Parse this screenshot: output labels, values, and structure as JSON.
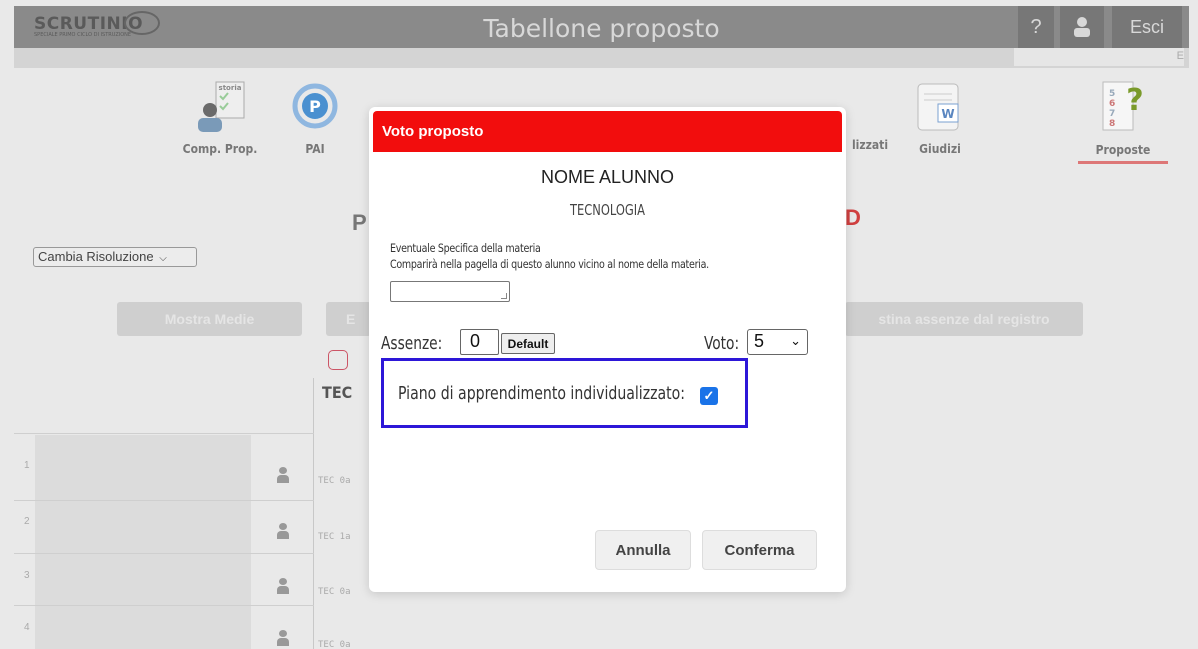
{
  "header": {
    "logo_text": "SCRUTINIO",
    "logo_sub": "SPECIALE PRIMO CICLO DI ISTRUZIONE",
    "title": "Tabellone proposto",
    "help_label": "?",
    "exit_label": "Esci",
    "strip_letter": "E"
  },
  "toolbar": {
    "comp_prop": "Comp. Prop.",
    "comp_prop_icon_text": "storia",
    "pai": "PAI",
    "pai_icon_text": "P",
    "personalizzati": "lizzati",
    "giudizi": "Giudizi",
    "giudizi_icon_text": "W",
    "proposte": "Proposte",
    "proposte_icon_text": "?"
  },
  "page": {
    "title_left": "P",
    "title_right": "D",
    "resolution_select": "Cambia Risoluzione",
    "btn_medie": "Mostra Medie",
    "btn_e": "E",
    "btn_assenze": "stina assenze dal registro",
    "column_header": "TEC",
    "rows": [
      {
        "num": "1",
        "tec": "TEC 0a"
      },
      {
        "num": "2",
        "tec": "TEC 1a"
      },
      {
        "num": "3",
        "tec": "TEC 0a"
      },
      {
        "num": "4",
        "tec": "TEC 0a"
      }
    ]
  },
  "modal": {
    "title": "Voto proposto",
    "student": "NOME ALUNNO",
    "subject": "TECNOLOGIA",
    "spec_line1": "Eventuale Specifica della materia",
    "spec_line2": "Comparirà nella pagella di questo alunno vicino al nome della materia.",
    "spec_value": "",
    "assenze_label": "Assenze:",
    "assenze_value": "0",
    "default_button": "Default",
    "voto_label": "Voto:",
    "voto_value": "5",
    "pai_label": "Piano di apprendimento individualizzato:",
    "pai_checked": true,
    "cancel_button": "Annulla",
    "confirm_button": "Conferma"
  },
  "colors": {
    "modal_header": "#f20d0d",
    "highlight_box": "#2d17d8",
    "checkbox": "#1a73e8"
  }
}
